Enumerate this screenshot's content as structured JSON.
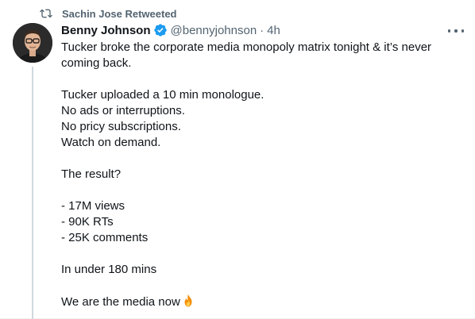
{
  "social_context": {
    "label": "Sachin Jose Retweeted",
    "icon": "retweet-icon"
  },
  "author": {
    "display_name": "Benny Johnson",
    "handle": "@bennyjohnson",
    "separator": "·",
    "time": "4h",
    "verified_icon": "verified-icon",
    "verified_color": "#1d9bf0"
  },
  "more_icon": "more-icon",
  "tweet": {
    "lines": [
      "Tucker broke the corporate media monopoly matrix tonight & it’s never",
      "coming back.",
      "",
      "Tucker uploaded a 10 min monologue.",
      "No ads or interruptions.",
      "No pricy subscriptions.",
      "Watch on demand.",
      "",
      "The result?",
      "",
      "- 17M views",
      "- 90K RTs",
      "- 25K comments",
      "",
      "In under 180 mins",
      "",
      "We are the media now"
    ],
    "emoji_icon": "fire-icon"
  },
  "colors": {
    "primary_text": "#0f1419",
    "secondary_text": "#536471",
    "thread_line": "#cfd9de",
    "accent": "#1d9bf0"
  }
}
